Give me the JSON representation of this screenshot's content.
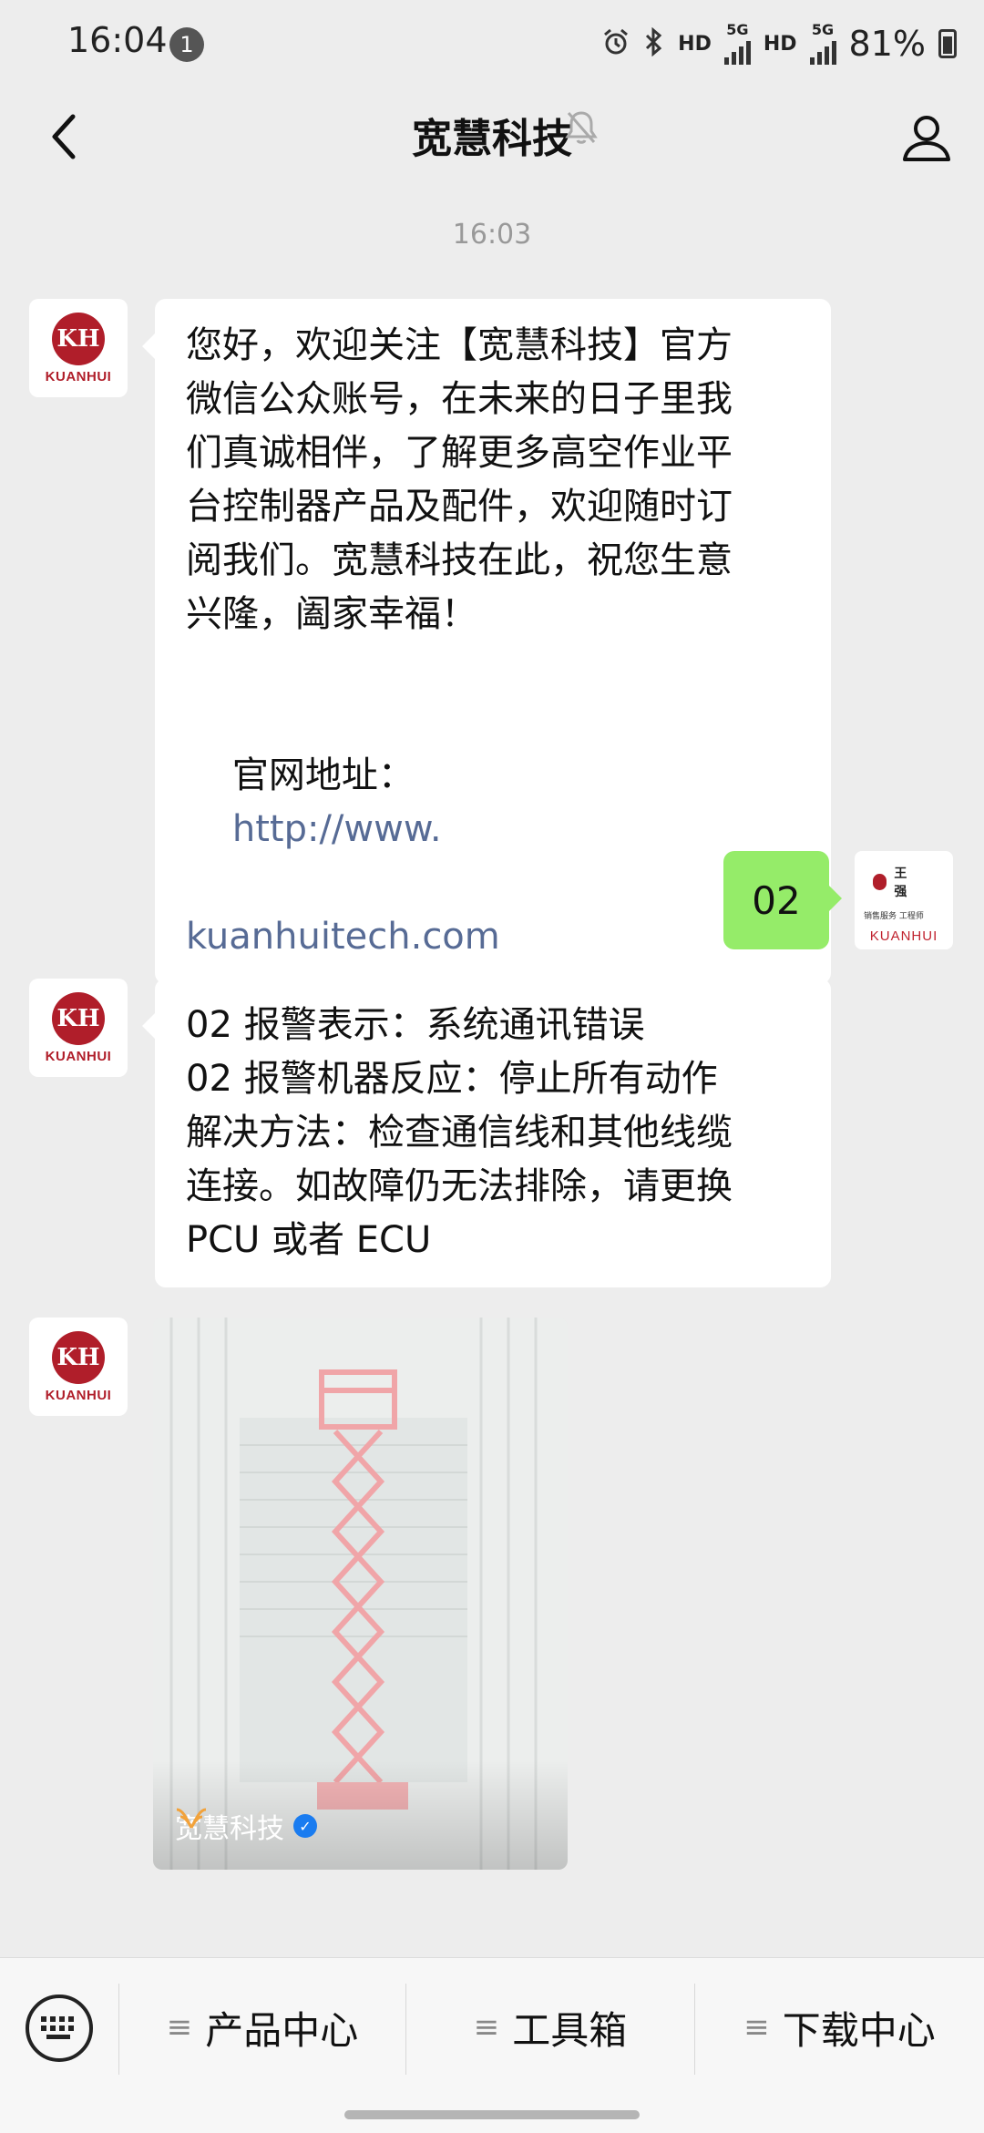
{
  "status_bar": {
    "time": "16:04",
    "notification_count": "1",
    "network_1": "HD",
    "network_1_gen": "5G",
    "network_2": "HD",
    "network_2_gen": "5G",
    "battery": "81%"
  },
  "header": {
    "title": "宽慧科技"
  },
  "chat": {
    "timestamp": "16:03",
    "avatar_brand": "KUANHUI",
    "messages": [
      {
        "lines": [
          "您好，欢迎关注【宽慧科技】官方",
          "微信公众账号，在未来的日子里我",
          "们真诚相伴，了解更多高空作业平",
          "台控制器产品及配件，欢迎随时订",
          "阅我们。宽慧科技在此，祝您生意",
          "兴隆，阖家幸福！"
        ],
        "website_label": "官网地址：",
        "website_url_1": "http://www.",
        "website_url_2": "kuanhuitech.com"
      },
      {
        "text": "02"
      },
      {
        "lines": [
          "02 报警表示：系统通讯错误",
          "02 报警机器反应：停止所有动作",
          "解决方法：检查通信线和其他线缆",
          "连接。如故障仍无法排除，请更换",
          "PCU 或者 ECU"
        ]
      },
      {
        "card_source": "宽慧科技"
      }
    ],
    "user_avatar": {
      "name": "王 强",
      "brand": "KUANHUI",
      "title": "销售服务 工程师"
    }
  },
  "bottom_menu": {
    "items": [
      "产品中心",
      "工具箱",
      "下载中心"
    ]
  }
}
